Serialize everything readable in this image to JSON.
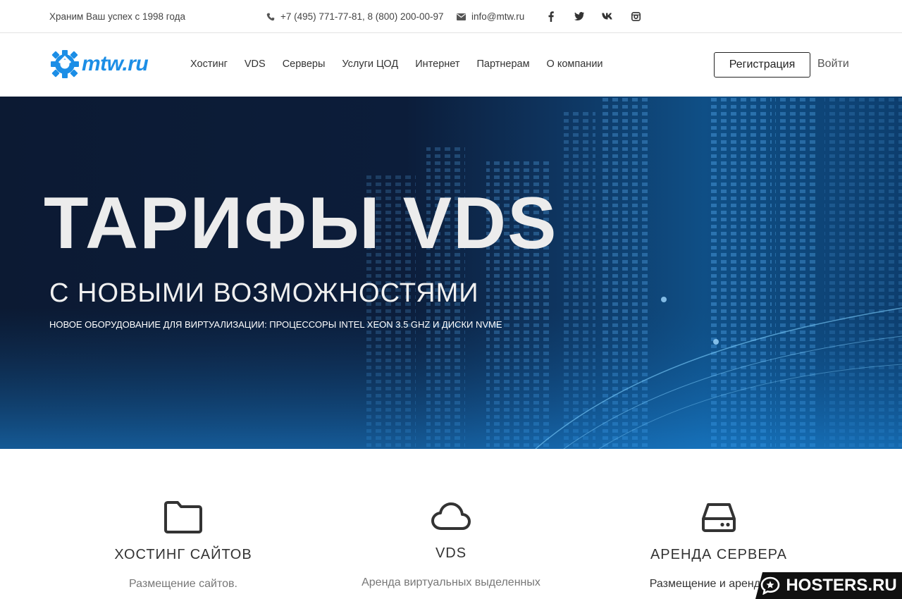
{
  "topbar": {
    "tagline": "Храним Ваш успех с 1998 года",
    "phones": "+7 (495) 771-77-81, 8 (800) 200-00-97",
    "email": "info@mtw.ru",
    "socials": [
      "facebook-icon",
      "twitter-icon",
      "vk-icon",
      "instagram-icon"
    ]
  },
  "header": {
    "logo_text": "mtw.ru",
    "menu": [
      "Хостинг",
      "VDS",
      "Серверы",
      "Услуги ЦОД",
      "Интернет",
      "Партнерам",
      "О компании"
    ],
    "register_label": "Регистрация",
    "login_label": "Войти"
  },
  "hero": {
    "title": "ТАРИФЫ VDS",
    "subtitle": "С НОВЫМИ ВОЗМОЖНОСТЯМИ",
    "description": "НОВОЕ ОБОРУДОВАНИЕ ДЛЯ ВИРТУАЛИЗАЦИИ: ПРОЦЕССОРЫ INTEL XEON 3.5 GHZ И ДИСКИ NVME"
  },
  "services": [
    {
      "title": "ХОСТИНГ САЙТОВ",
      "text": "Размещение сайтов.",
      "icon": "folder-icon"
    },
    {
      "title": "VDS",
      "text": "Аренда виртуальных выделенных",
      "icon": "cloud-icon"
    },
    {
      "title": "АРЕНДА СЕРВЕРА",
      "text": "Размещение и аренда сер",
      "icon": "server-icon"
    }
  ],
  "watermark": "HOSTERS.RU",
  "colors": {
    "brand": "#1c8ee6",
    "hero_dark": "#0c1a33",
    "hero_blue": "#0f4f86"
  }
}
